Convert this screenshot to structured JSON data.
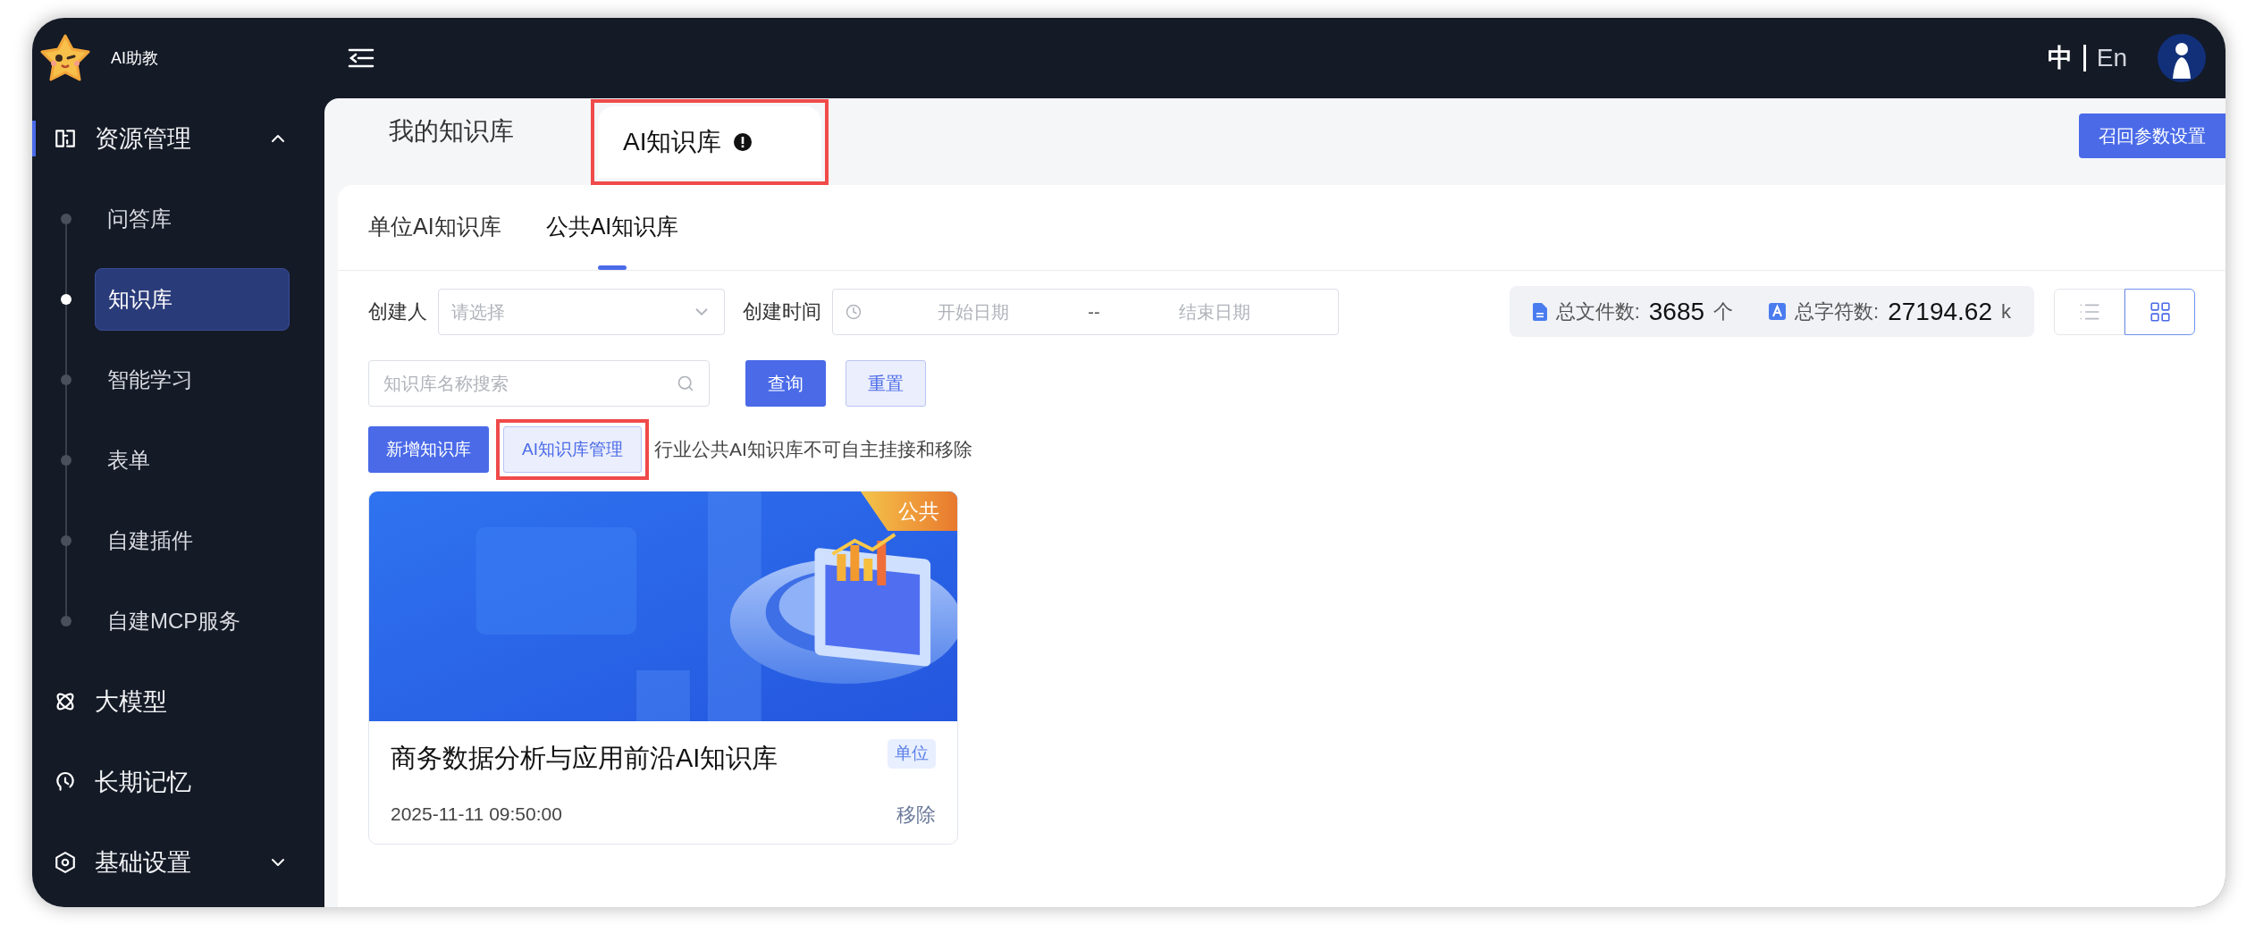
{
  "app": {
    "name": "AI助教"
  },
  "header": {
    "languages": [
      {
        "label": "中",
        "selected": true
      },
      {
        "label": "En",
        "selected": false
      }
    ]
  },
  "sidebar": {
    "items": [
      {
        "label": "资源管理",
        "kind": "group",
        "expanded": true,
        "selected": true,
        "children": [
          {
            "label": "问答库",
            "selected": false
          },
          {
            "label": "知识库",
            "selected": true
          },
          {
            "label": "智能学习",
            "selected": false
          },
          {
            "label": "表单",
            "selected": false
          },
          {
            "label": "自建插件",
            "selected": false
          },
          {
            "label": "自建MCP服务",
            "selected": false
          }
        ]
      },
      {
        "label": "大模型",
        "kind": "item",
        "selected": false
      },
      {
        "label": "长期记忆",
        "kind": "item",
        "selected": false
      },
      {
        "label": "基础设置",
        "kind": "group",
        "expanded": false,
        "selected": false
      }
    ]
  },
  "tabs": [
    {
      "label": "我的知识库",
      "selected": false,
      "notice": false,
      "highlighted": false
    },
    {
      "label": "AI知识库",
      "selected": true,
      "notice": true,
      "highlighted": true
    }
  ],
  "recall_button": "召回参数设置",
  "sub_tabs": [
    {
      "label": "单位AI知识库",
      "selected": false
    },
    {
      "label": "公共AI知识库",
      "selected": true
    }
  ],
  "filters": {
    "creator": {
      "label": "创建人",
      "placeholder": "请选择"
    },
    "created_time": {
      "label": "创建时间",
      "start_placeholder": "开始日期",
      "separator": "--",
      "end_placeholder": "结束日期"
    },
    "search": {
      "placeholder": "知识库名称搜索"
    },
    "buttons": [
      {
        "label": "查询",
        "kind": "primary"
      },
      {
        "label": "重置",
        "kind": "secondary"
      }
    ]
  },
  "stats": [
    {
      "label": "总文件数:",
      "value": "3685",
      "unit": "个"
    },
    {
      "label": "总字符数:",
      "value": "27194.62",
      "unit": "k"
    }
  ],
  "view_modes": [
    {
      "kind": "list",
      "selected": false
    },
    {
      "kind": "grid",
      "selected": true
    }
  ],
  "actions": [
    {
      "label": "新增知识库",
      "kind": "primary",
      "highlighted": false
    },
    {
      "label": "AI知识库管理",
      "kind": "secondary",
      "highlighted": true
    }
  ],
  "notice": "行业公共AI知识库不可自主挂接和移除",
  "cards": [
    {
      "badge": "公共",
      "title": "商务数据分析与应用前沿AI知识库",
      "tag": "单位",
      "date": "2025-11-11 09:50:00",
      "action": "移除"
    }
  ]
}
